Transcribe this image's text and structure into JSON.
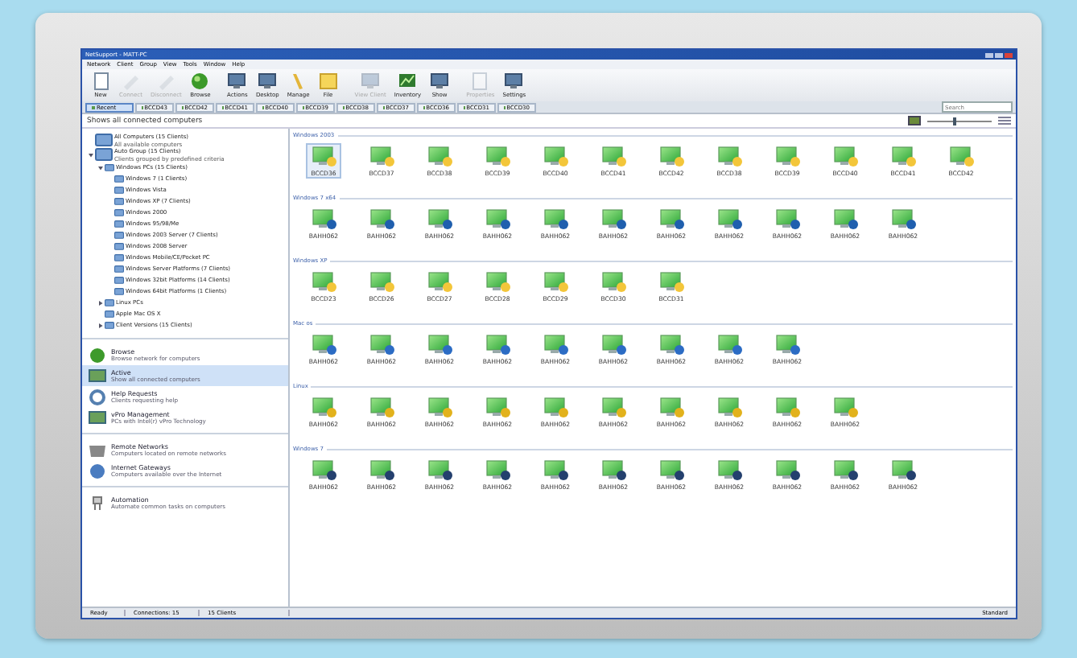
{
  "window": {
    "title": "NetSupport - MATT-PC"
  },
  "menu": [
    "Network",
    "Client",
    "Group",
    "View",
    "Tools",
    "Window",
    "Help"
  ],
  "toolbar": [
    {
      "label": "New",
      "disabled": false
    },
    {
      "label": "Connect",
      "disabled": true
    },
    {
      "label": "Disconnect",
      "disabled": true
    },
    {
      "label": "Browse",
      "disabled": false
    },
    {
      "label": "Actions",
      "disabled": false
    },
    {
      "label": "Desktop",
      "disabled": false
    },
    {
      "label": "Manage",
      "disabled": false
    },
    {
      "label": "File",
      "disabled": false
    },
    {
      "label": "View Client",
      "disabled": true
    },
    {
      "label": "Inventory",
      "disabled": false
    },
    {
      "label": "Show",
      "disabled": false
    },
    {
      "label": "Properties",
      "disabled": true
    },
    {
      "label": "Settings",
      "disabled": false
    }
  ],
  "tabs": [
    {
      "label": "Recent",
      "selected": true
    },
    {
      "label": "BCCD43",
      "selected": false
    },
    {
      "label": "BCCD42",
      "selected": false
    },
    {
      "label": "BCCD41",
      "selected": false
    },
    {
      "label": "BCCD40",
      "selected": false
    },
    {
      "label": "BCCD39",
      "selected": false
    },
    {
      "label": "BCCD38",
      "selected": false
    },
    {
      "label": "BCCD37",
      "selected": false
    },
    {
      "label": "BCCD36",
      "selected": false
    },
    {
      "label": "BCCD31",
      "selected": false
    },
    {
      "label": "BCCD30",
      "selected": false
    }
  ],
  "search": {
    "placeholder": "Search"
  },
  "header": {
    "text": "Shows all connected computers",
    "zoom": {
      "level": 0.4
    }
  },
  "tree": [
    {
      "label": "All Computers (15 Clients)",
      "subtitle": "All available computers"
    },
    {
      "label": "Auto Group (15 Clients)",
      "subtitle": "Clients grouped by predefined criteria",
      "expanded": true,
      "children": [
        {
          "label": "Windows PCs (15 Clients)",
          "expanded": true,
          "children": [
            {
              "label": "Windows 7 (1 Clients)"
            },
            {
              "label": "Windows Vista"
            },
            {
              "label": "Windows XP (7 Clients)"
            },
            {
              "label": "Windows 2000"
            },
            {
              "label": "Windows 95/98/Me"
            },
            {
              "label": "Windows 2003 Server (7 Clients)"
            },
            {
              "label": "Windows 2008 Server"
            },
            {
              "label": "Windows Mobile/CE/Pocket PC"
            },
            {
              "label": "Windows Server Platforms (7 Clients)"
            },
            {
              "label": "Windows 32bit Platforms (14 Clients)"
            },
            {
              "label": "Windows 64bit Platforms (1 Clients)"
            }
          ]
        },
        {
          "label": "Linux PCs",
          "expanded": false
        },
        {
          "label": "Apple Mac OS X"
        },
        {
          "label": "Client Versions (15 Clients)",
          "expanded": false
        }
      ]
    }
  ],
  "nav": [
    [
      {
        "title": "Browse",
        "subtitle": "Browse network for computers",
        "selected": false
      },
      {
        "title": "Active",
        "subtitle": "Show all connected computers",
        "selected": true
      },
      {
        "title": "Help Requests",
        "subtitle": "Clients requesting help",
        "selected": false
      },
      {
        "title": "vPro Management",
        "subtitle": "PCs with Intel(r) vPro Technology",
        "selected": false
      }
    ],
    [
      {
        "title": "Remote Networks",
        "subtitle": "Computers located on remote networks",
        "selected": false
      },
      {
        "title": "Internet Gateways",
        "subtitle": "Computers available over the Internet",
        "selected": false
      }
    ],
    [
      {
        "title": "Automation",
        "subtitle": "Automate common tasks on computers",
        "selected": false
      }
    ]
  ],
  "groups": [
    {
      "title": "Windows 2003",
      "kind": "flag",
      "clients": [
        {
          "name": "BCCD36",
          "selected": true
        },
        {
          "name": "BCCD37",
          "selected": false
        },
        {
          "name": "BCCD38",
          "selected": false
        },
        {
          "name": "BCCD39",
          "selected": false
        },
        {
          "name": "BCCD40",
          "selected": false
        },
        {
          "name": "BCCD41",
          "selected": false
        },
        {
          "name": "BCCD42",
          "selected": false
        },
        {
          "name": "BCCD38",
          "selected": false
        },
        {
          "name": "BCCD39",
          "selected": false
        },
        {
          "name": "BCCD40",
          "selected": false
        },
        {
          "name": "BCCD41",
          "selected": false
        },
        {
          "name": "BCCD42",
          "selected": false
        }
      ]
    },
    {
      "title": "Windows 7 x64",
      "kind": "orb",
      "clients": [
        {
          "name": "BAHH062",
          "selected": false
        },
        {
          "name": "BAHH062",
          "selected": false
        },
        {
          "name": "BAHH062",
          "selected": false
        },
        {
          "name": "BAHH062",
          "selected": false
        },
        {
          "name": "BAHH062",
          "selected": false
        },
        {
          "name": "BAHH062",
          "selected": false
        },
        {
          "name": "BAHH062",
          "selected": false
        },
        {
          "name": "BAHH062",
          "selected": false
        },
        {
          "name": "BAHH062",
          "selected": false
        },
        {
          "name": "BAHH062",
          "selected": false
        },
        {
          "name": "BAHH062",
          "selected": false
        }
      ]
    },
    {
      "title": "Windows XP",
      "kind": "flag",
      "clients": [
        {
          "name": "BCCD23",
          "selected": false
        },
        {
          "name": "BCCD26",
          "selected": false
        },
        {
          "name": "BCCD27",
          "selected": false
        },
        {
          "name": "BCCD28",
          "selected": false
        },
        {
          "name": "BCCD29",
          "selected": false
        },
        {
          "name": "BCCD30",
          "selected": false
        },
        {
          "name": "BCCD31",
          "selected": false
        }
      ]
    },
    {
      "title": "Mac os",
      "kind": "mac",
      "clients": [
        {
          "name": "BAHH062",
          "selected": false
        },
        {
          "name": "BAHH062",
          "selected": false
        },
        {
          "name": "BAHH062",
          "selected": false
        },
        {
          "name": "BAHH062",
          "selected": false
        },
        {
          "name": "BAHH062",
          "selected": false
        },
        {
          "name": "BAHH062",
          "selected": false
        },
        {
          "name": "BAHH062",
          "selected": false
        },
        {
          "name": "BAHH062",
          "selected": false
        },
        {
          "name": "BAHH062",
          "selected": false
        }
      ]
    },
    {
      "title": "Linux",
      "kind": "penguin",
      "clients": [
        {
          "name": "BAHH062",
          "selected": false
        },
        {
          "name": "BAHH062",
          "selected": false
        },
        {
          "name": "BAHH062",
          "selected": false
        },
        {
          "name": "BAHH062",
          "selected": false
        },
        {
          "name": "BAHH062",
          "selected": false
        },
        {
          "name": "BAHH062",
          "selected": false
        },
        {
          "name": "BAHH062",
          "selected": false
        },
        {
          "name": "BAHH062",
          "selected": false
        },
        {
          "name": "BAHH062",
          "selected": false
        },
        {
          "name": "BAHH062",
          "selected": false
        }
      ]
    },
    {
      "title": "Windows 7",
      "kind": "info",
      "clients": [
        {
          "name": "BAHH062",
          "selected": false
        },
        {
          "name": "BAHH062",
          "selected": false
        },
        {
          "name": "BAHH062",
          "selected": false
        },
        {
          "name": "BAHH062",
          "selected": false
        },
        {
          "name": "BAHH062",
          "selected": false
        },
        {
          "name": "BAHH062",
          "selected": false
        },
        {
          "name": "BAHH062",
          "selected": false
        },
        {
          "name": "BAHH062",
          "selected": false
        },
        {
          "name": "BAHH062",
          "selected": false
        },
        {
          "name": "BAHH062",
          "selected": false
        },
        {
          "name": "BAHH062",
          "selected": false
        }
      ]
    }
  ],
  "status_bar": [
    "Ready",
    "Connections: 15",
    "15 Clients",
    "Standard"
  ]
}
